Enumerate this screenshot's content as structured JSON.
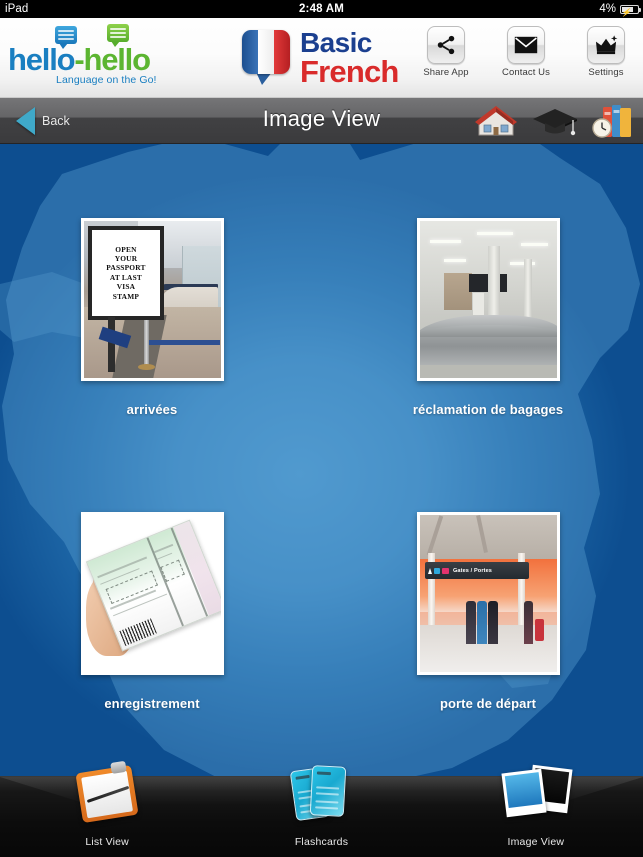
{
  "status_bar": {
    "carrier": "iPad",
    "time": "2:48 AM",
    "battery_percent": "4%",
    "battery_icon": "battery-charging-icon"
  },
  "header": {
    "logo": {
      "text_part1": "hello",
      "separator": "-",
      "text_part2": "hello",
      "tagline": "Language on the Go!",
      "color_blue": "#1a7fc1",
      "color_green": "#5cb531"
    },
    "brand": {
      "line1": "Basic",
      "line2": "French",
      "color_blue": "#1b3f8f",
      "color_red": "#d92b2b",
      "flag_icon": "french-flag-speech-bubble-icon"
    },
    "tools": [
      {
        "label": "Share App",
        "icon": "share-icon"
      },
      {
        "label": "Contact Us",
        "icon": "envelope-icon"
      },
      {
        "label": "Settings",
        "icon": "settings-crown-icon"
      }
    ]
  },
  "navbar": {
    "back_label": "Back",
    "back_icon": "back-arrow-icon",
    "title": "Image View",
    "tools": [
      {
        "icon": "house-icon",
        "name": "home"
      },
      {
        "icon": "graduation-cap-icon",
        "name": "learn"
      },
      {
        "icon": "books-clock-icon",
        "name": "review"
      }
    ]
  },
  "content": {
    "background_color_center": "#4b96cd",
    "background_color_edge": "#0d4e90",
    "map_shape": "france-map-silhouette",
    "items": [
      {
        "caption": "arrivées",
        "image_name": "airport-arrivals-passport-sign-photo",
        "sign_text": "OPEN\nYOUR\nPASSPORT\nAT LAST\nVISA\nSTAMP"
      },
      {
        "caption": "réclamation de bagages",
        "image_name": "baggage-claim-carousel-photo"
      },
      {
        "caption": "enregistrement",
        "image_name": "boarding-pass-in-hand-photo"
      },
      {
        "caption": "porte de départ",
        "image_name": "departure-gate-terminal-photo",
        "sign_text": "Gates / Portes"
      }
    ]
  },
  "tabbar": {
    "tabs": [
      {
        "label": "List View",
        "icon": "clipboard-pen-icon",
        "selected": false
      },
      {
        "label": "Flashcards",
        "icon": "flashcards-icon",
        "selected": false
      },
      {
        "label": "Image View",
        "icon": "polaroid-photos-icon",
        "selected": true
      }
    ]
  }
}
